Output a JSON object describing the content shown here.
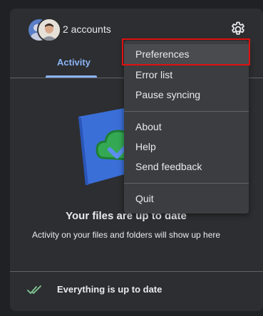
{
  "header": {
    "accounts_label": "2 accounts",
    "settings_icon": "gear-icon"
  },
  "tabs": [
    {
      "label": "Activity",
      "selected": true
    }
  ],
  "activity": {
    "title": "Your files are up to date",
    "subtitle": "Activity on your files and folders will show up here",
    "illustration_icon": "cloud-check-folder-icon"
  },
  "status": {
    "label": "Everything is up to date",
    "icon": "double-check-icon"
  },
  "menu": {
    "items": [
      {
        "label": "Preferences",
        "highlighted": true
      },
      {
        "label": "Error list"
      },
      {
        "label": "Pause syncing"
      },
      {
        "label": "About"
      },
      {
        "label": "Help"
      },
      {
        "label": "Send feedback"
      },
      {
        "label": "Quit"
      }
    ]
  },
  "colors": {
    "background": "#202124",
    "panel": "#2d2e31",
    "menu": "#3c3d40",
    "accent": "#8ab4f8",
    "highlight_ring": "#e01010",
    "check_green": "#81c995"
  }
}
